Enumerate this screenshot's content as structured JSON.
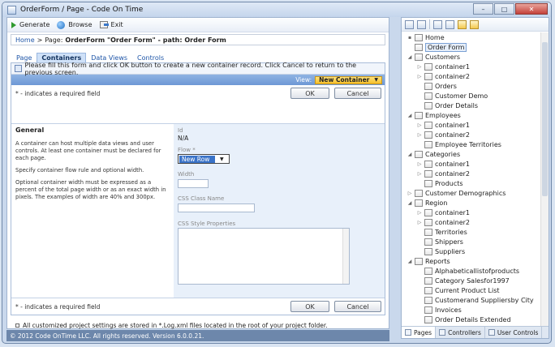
{
  "window": {
    "title": "OrderForm / Page - Code On Time",
    "minimize": "–",
    "maximize": "□",
    "close": "✕"
  },
  "toolbar": {
    "generate": "Generate",
    "browse": "Browse",
    "exit": "Exit"
  },
  "breadcrumb": {
    "home": "Home",
    "separator": ">",
    "current": "Page:",
    "current_bold": "OrderForm \"Order Form\" - path: Order Form"
  },
  "tabs": [
    "Page",
    "Containers",
    "Data Views",
    "Controls"
  ],
  "form": {
    "info": "Please fill this form and click OK button to create a new container record. Click Cancel to return to the previous screen.",
    "view_label": "View:",
    "view_value": "New Container",
    "view_caret": "▼",
    "required_note": "* - indicates a required field",
    "ok": "OK",
    "cancel": "Cancel",
    "section_title": "General",
    "desc1": "A container can host multiple data views and user controls. At least one container must be declared for each page.",
    "desc2": "Specify container flow rule and optional width.",
    "desc3": "Optional container width must be expressed as a percent of the total page width or as an exact width in pixels. The examples of width are 40% and 300px.",
    "fields": {
      "id_label": "Id",
      "id_value": "N/A",
      "flow_label": "Flow *",
      "flow_value": "New Row",
      "flow_caret": "▼",
      "width_label": "Width",
      "css_class_label": "CSS Class Name",
      "css_style_label": "CSS Style Properties"
    }
  },
  "footnote": "All customized project settings are stored in *.Log.xml files located in the root of your project folder.",
  "status": "© 2012 Code OnTime LLC. All rights reserved. Version 6.0.0.21.",
  "tree": [
    {
      "label": "Home",
      "level": 0,
      "exp": "▪"
    },
    {
      "label": "Order Form",
      "level": 0,
      "exp": "",
      "selected": true
    },
    {
      "label": "Customers",
      "level": 0,
      "exp": "◢"
    },
    {
      "label": "container1",
      "level": 1,
      "exp": "▷"
    },
    {
      "label": "container2",
      "level": 1,
      "exp": "▷"
    },
    {
      "label": "Orders",
      "level": 1,
      "exp": ""
    },
    {
      "label": "Customer Demo",
      "level": 1,
      "exp": ""
    },
    {
      "label": "Order Details",
      "level": 1,
      "exp": ""
    },
    {
      "label": "Employees",
      "level": 0,
      "exp": "◢"
    },
    {
      "label": "container1",
      "level": 1,
      "exp": "▷"
    },
    {
      "label": "container2",
      "level": 1,
      "exp": "▷"
    },
    {
      "label": "Employee Territories",
      "level": 1,
      "exp": ""
    },
    {
      "label": "Categories",
      "level": 0,
      "exp": "◢"
    },
    {
      "label": "container1",
      "level": 1,
      "exp": "▷"
    },
    {
      "label": "container2",
      "level": 1,
      "exp": "▷"
    },
    {
      "label": "Products",
      "level": 1,
      "exp": ""
    },
    {
      "label": "Customer Demographics",
      "level": 0,
      "exp": "▷"
    },
    {
      "label": "Region",
      "level": 0,
      "exp": "◢"
    },
    {
      "label": "container1",
      "level": 1,
      "exp": "▷"
    },
    {
      "label": "container2",
      "level": 1,
      "exp": "▷"
    },
    {
      "label": "Territories",
      "level": 1,
      "exp": ""
    },
    {
      "label": "Shippers",
      "level": 1,
      "exp": ""
    },
    {
      "label": "Suppliers",
      "level": 1,
      "exp": ""
    },
    {
      "label": "Reports",
      "level": 0,
      "exp": "◢"
    },
    {
      "label": "Alphabeticallistofproducts",
      "level": 1,
      "exp": ""
    },
    {
      "label": "Category Salesfor1997",
      "level": 1,
      "exp": ""
    },
    {
      "label": "Current Product List",
      "level": 1,
      "exp": ""
    },
    {
      "label": "Customerand Suppliersby City",
      "level": 1,
      "exp": ""
    },
    {
      "label": "Invoices",
      "level": 1,
      "exp": ""
    },
    {
      "label": "Order Details Extended",
      "level": 1,
      "exp": ""
    }
  ],
  "right_tabs": [
    "Pages",
    "Controllers",
    "User Controls"
  ]
}
